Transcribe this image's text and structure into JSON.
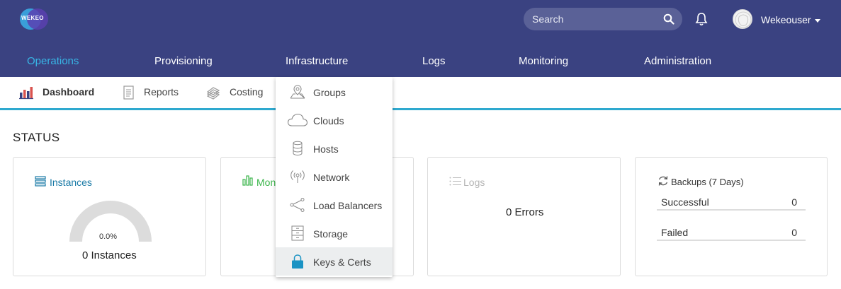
{
  "header": {
    "logo_text": "WEKEO",
    "search_placeholder": "Search",
    "username": "Wekeouser"
  },
  "main_nav": [
    {
      "label": "Operations",
      "active": true
    },
    {
      "label": "Provisioning",
      "active": false
    },
    {
      "label": "Infrastructure",
      "active": false
    },
    {
      "label": "Logs",
      "active": false
    },
    {
      "label": "Monitoring",
      "active": false
    },
    {
      "label": "Administration",
      "active": false
    }
  ],
  "sub_nav": [
    {
      "label": "Dashboard",
      "icon": "bar-chart-icon",
      "active": true
    },
    {
      "label": "Reports",
      "icon": "document-icon",
      "active": false
    },
    {
      "label": "Costing",
      "icon": "money-stack-icon",
      "active": false
    }
  ],
  "infrastructure_menu": [
    {
      "label": "Groups",
      "icon": "map-pin-icon"
    },
    {
      "label": "Clouds",
      "icon": "cloud-icon"
    },
    {
      "label": "Hosts",
      "icon": "database-icon"
    },
    {
      "label": "Network",
      "icon": "signal-icon"
    },
    {
      "label": "Load Balancers",
      "icon": "share-icon"
    },
    {
      "label": "Storage",
      "icon": "storage-cabinet-icon"
    },
    {
      "label": "Keys & Certs",
      "icon": "lock-icon",
      "highlighted": true
    }
  ],
  "status": {
    "title": "STATUS",
    "instances": {
      "title": "Instances",
      "gauge_value": "0.0%",
      "count": "0 Instances"
    },
    "monitoring": {
      "title": "Mon"
    },
    "logs": {
      "title": "Logs",
      "summary": "0 Errors"
    },
    "backups": {
      "title": "Backups (7 Days)",
      "rows": [
        {
          "label": "Successful",
          "value": "0"
        },
        {
          "label": "Failed",
          "value": "0"
        }
      ]
    }
  },
  "colors": {
    "topbar": "#3a4281",
    "active_nav": "#38b6e6",
    "accent_line": "#2ea9cf",
    "link_blue": "#1a7aa6",
    "monitor_green": "#3ab54a",
    "lock_blue": "#1a93c4"
  }
}
